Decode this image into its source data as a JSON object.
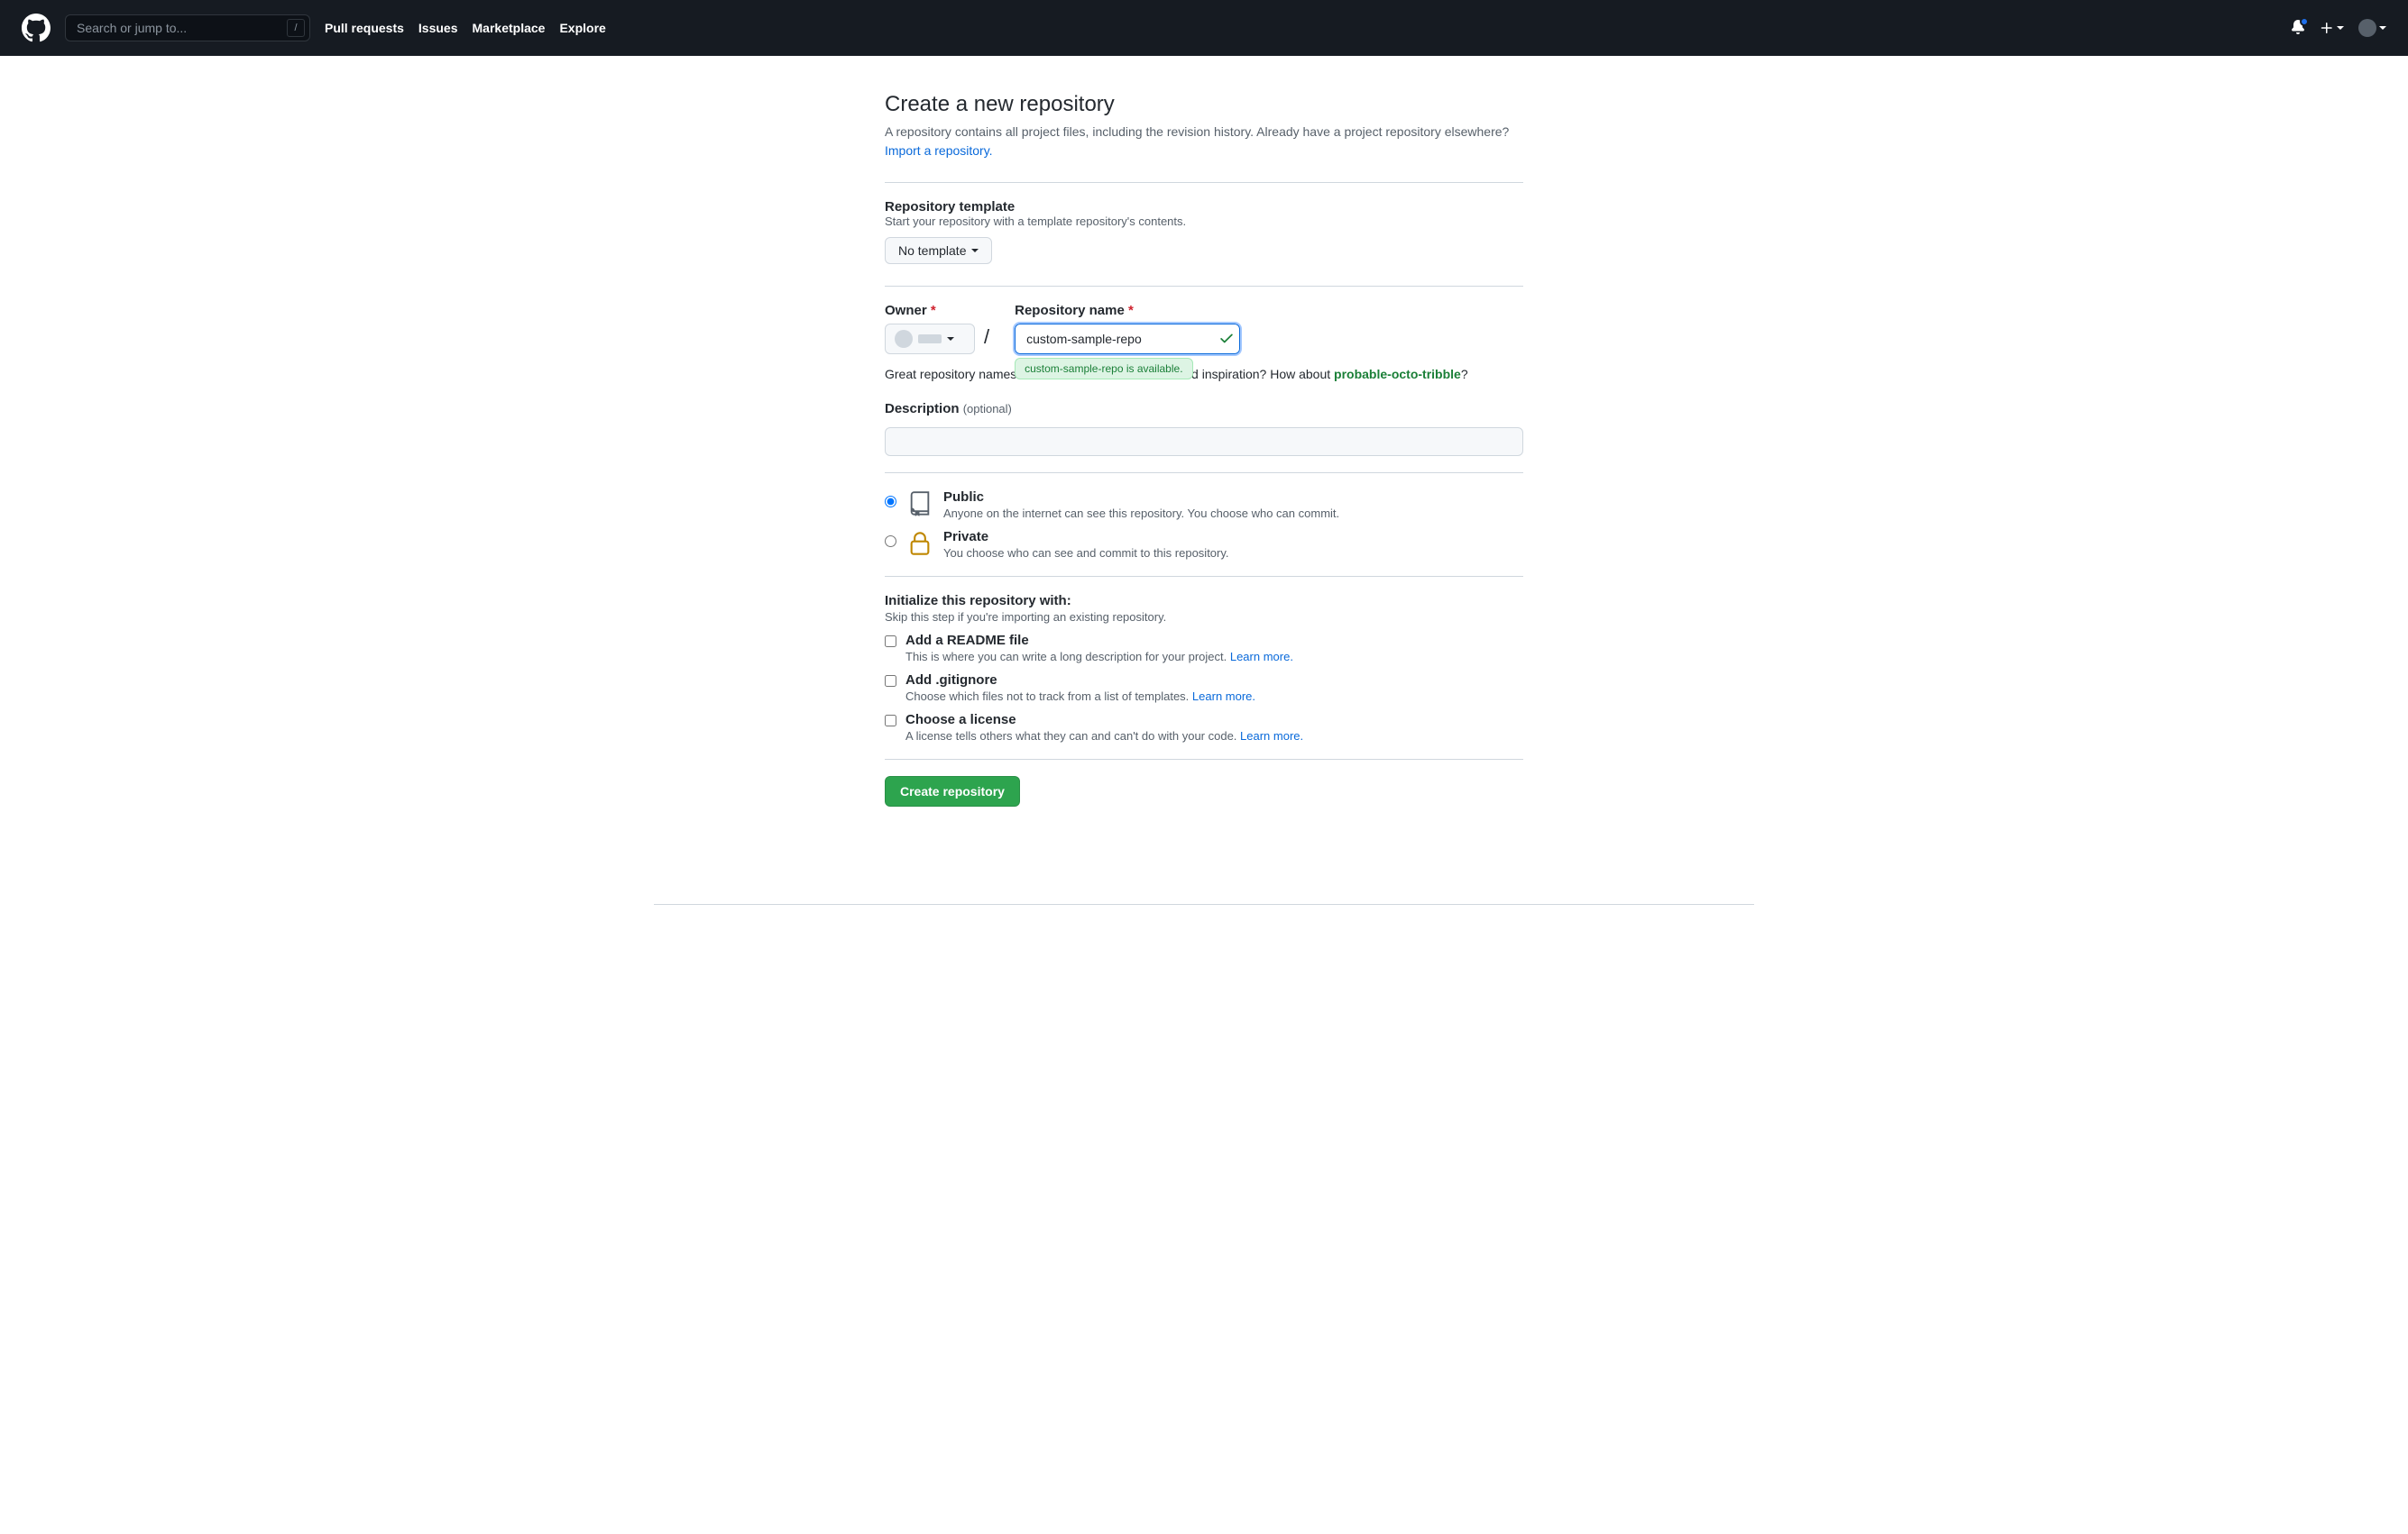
{
  "header": {
    "search_placeholder": "Search or jump to...",
    "slash_key": "/",
    "nav": [
      "Pull requests",
      "Issues",
      "Marketplace",
      "Explore"
    ]
  },
  "page": {
    "title": "Create a new repository",
    "subtext": "A repository contains all project files, including the revision history. Already have a project repository elsewhere? ",
    "import_link": "Import a repository."
  },
  "template": {
    "title": "Repository template",
    "desc": "Start your repository with a template repository's contents.",
    "button": "No template"
  },
  "owner_label": "Owner",
  "name_label": "Repository name",
  "repo_name_value": "custom-sample-repo",
  "available_msg": "custom-sample-repo is available.",
  "inspiration_pre": "Great repository names are short and memorable. Need inspiration? How about ",
  "inspiration_name": "probable-octo-tribble",
  "inspiration_q": "?",
  "description_label": "Description",
  "description_optional": "(optional)",
  "visibility": {
    "public": {
      "title": "Public",
      "desc": "Anyone on the internet can see this repository. You choose who can commit."
    },
    "private": {
      "title": "Private",
      "desc": "You choose who can see and commit to this repository."
    }
  },
  "init": {
    "title": "Initialize this repository with:",
    "skip": "Skip this step if you're importing an existing repository.",
    "readme": {
      "title": "Add a README file",
      "desc": "This is where you can write a long description for your project. ",
      "link": "Learn more."
    },
    "gitignore": {
      "title": "Add .gitignore",
      "desc": "Choose which files not to track from a list of templates. ",
      "link": "Learn more."
    },
    "license": {
      "title": "Choose a license",
      "desc": "A license tells others what they can and can't do with your code. ",
      "link": "Learn more."
    }
  },
  "create_button": "Create repository"
}
